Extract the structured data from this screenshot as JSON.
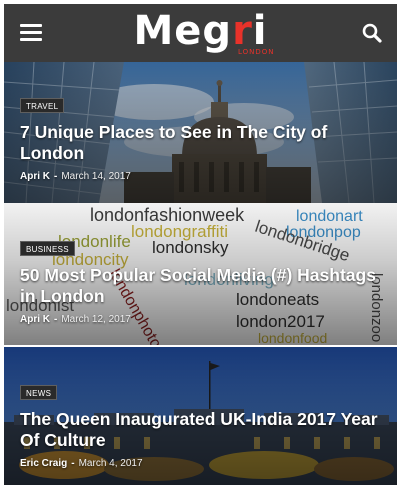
{
  "header": {
    "logo_main": "Meg",
    "logo_accent_r": "r",
    "logo_tail": "i",
    "logo_tagline": "LONDON"
  },
  "colors": {
    "header_bg": "#3b3b3b",
    "accent": "#e8322a",
    "badge_bg": "#2a2a2a"
  },
  "icons": {
    "menu": "hamburger-menu-icon",
    "search": "search-icon"
  },
  "articles": [
    {
      "category": "TRAVEL",
      "title": "7 Unique Places to See in The City of London",
      "author": "Apri K",
      "separator": "-",
      "date": "March 14, 2017"
    },
    {
      "category": "BUSINESS",
      "title": "50 Most Popular Social Media (#) Hashtags in London",
      "author": "Apri K",
      "separator": "-",
      "date": "March 12, 2017",
      "wordcloud": [
        "londonfashionweek",
        "londonart",
        "londonlife",
        "londongraffiti",
        "londonpop",
        "londonsky",
        "londoncity",
        "londonbridge",
        "londonliving",
        "londonist",
        "londoneats",
        "londonphotography",
        "london2017",
        "londonfood",
        "londonzoo"
      ]
    },
    {
      "category": "NEWS",
      "title": "The Queen Inaugurated UK-India 2017 Year Of Culture",
      "author": "Eric Craig",
      "separator": "-",
      "date": "March 4, 2017"
    }
  ]
}
